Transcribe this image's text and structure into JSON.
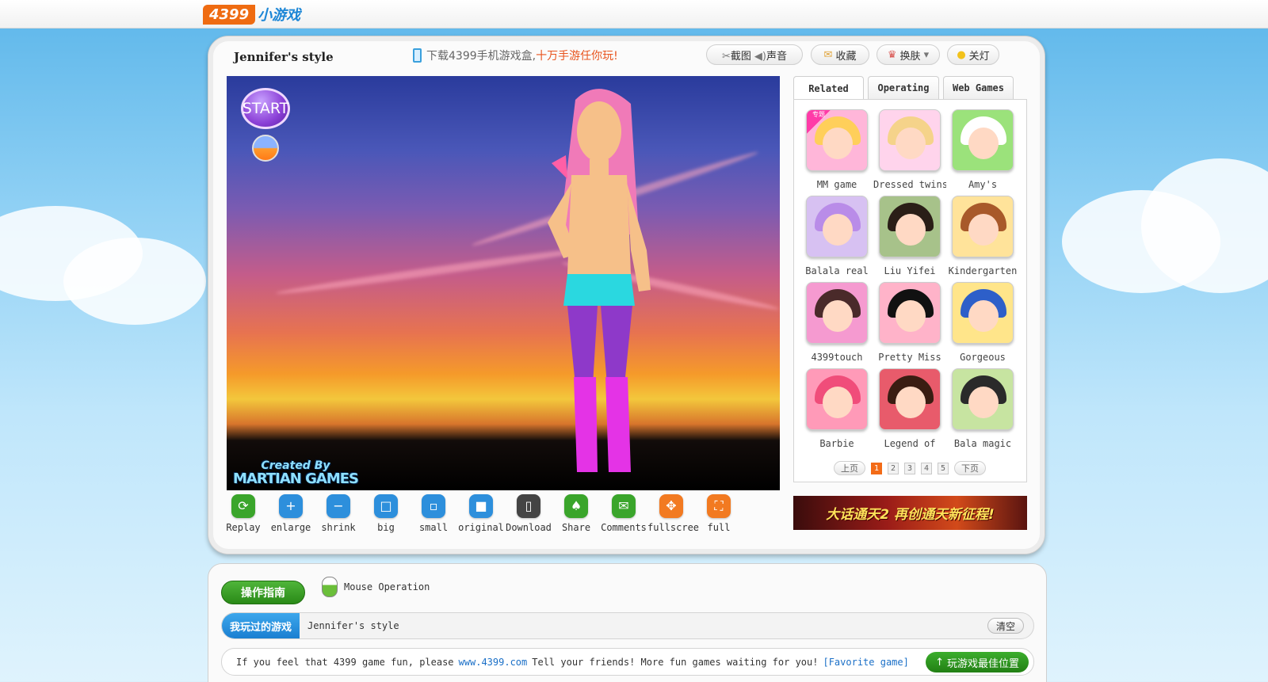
{
  "logo": {
    "number": "4399",
    "name": "小游戏"
  },
  "game": {
    "title": "Jennifer's style"
  },
  "promo": {
    "text": "下载4399手机游戏盒,",
    "highlight": "十万手游任你玩!"
  },
  "top_buttons": {
    "screenshot": "截图",
    "sound": "声音",
    "favorite": "收藏",
    "skin": "换肤",
    "lights": "关灯"
  },
  "stage": {
    "start_label": "START",
    "credit_line1": "Created By",
    "credit_line2": "MARTIAN GAMES"
  },
  "tabs": [
    {
      "label": "Related",
      "active": true
    },
    {
      "label": "Operating",
      "active": false
    },
    {
      "label": "Web Games",
      "active": false
    }
  ],
  "related_games": [
    {
      "caption": "MM game",
      "hair": "#ffcf5a",
      "bg": "#ffb6d9",
      "badge": "专题"
    },
    {
      "caption": "Dressed twins",
      "hair": "#f5d38a",
      "bg": "#ffd4ec"
    },
    {
      "caption": "Amy's",
      "hair": "#ffffff",
      "bg": "#9be27b"
    },
    {
      "caption": "Balala real",
      "hair": "#b98ce8",
      "bg": "#d7c1f2"
    },
    {
      "caption": "Liu Yifei",
      "hair": "#2a1e17",
      "bg": "#a7c28a"
    },
    {
      "caption": "Kindergarten",
      "hair": "#a8592a",
      "bg": "#ffe39a"
    },
    {
      "caption": "4399touch",
      "hair": "#4a2a2a",
      "bg": "#f59ad0"
    },
    {
      "caption": "Pretty Miss",
      "hair": "#111111",
      "bg": "#ffb3c9"
    },
    {
      "caption": "Gorgeous",
      "hair": "#2d5fc9",
      "bg": "#ffe58a"
    },
    {
      "caption": "Barbie",
      "hair": "#f04d7a",
      "bg": "#ff9ab8"
    },
    {
      "caption": "Legend of",
      "hair": "#3a1d12",
      "bg": "#e85b6b"
    },
    {
      "caption": "Bala magic",
      "hair": "#2a2a2a",
      "bg": "#c7e4a1"
    }
  ],
  "pager": {
    "prev": "上页",
    "next": "下页",
    "pages": [
      "1",
      "2",
      "3",
      "4",
      "5"
    ],
    "current": "1"
  },
  "toolbar": [
    {
      "label": "Replay",
      "icon": "⟳",
      "color": "#3aa52b"
    },
    {
      "label": "enlarge",
      "icon": "+",
      "color": "#2d8fdc"
    },
    {
      "label": "shrink",
      "icon": "−",
      "color": "#2d8fdc"
    },
    {
      "label": "big",
      "icon": "□",
      "color": "#2d8fdc"
    },
    {
      "label": "small",
      "icon": "▫",
      "color": "#2d8fdc"
    },
    {
      "label": "original",
      "icon": "■",
      "color": "#2d8fdc"
    },
    {
      "label": "Download",
      "icon": "▯",
      "color": "#444444"
    },
    {
      "label": "Share",
      "icon": "♠",
      "color": "#3aa52b"
    },
    {
      "label": "Comments",
      "icon": "✉",
      "color": "#3aa52b"
    },
    {
      "label": "fullscree",
      "icon": "✥",
      "color": "#f27a21"
    },
    {
      "label": "full",
      "icon": "⛶",
      "color": "#f27a21"
    }
  ],
  "ad_banner": {
    "text": "大话通天2 再创通天新征程!"
  },
  "guide": {
    "button": "操作指南",
    "mouse_op": "Mouse Operation"
  },
  "history": {
    "label": "我玩过的游戏",
    "game": "Jennifer's style",
    "clear": "清空"
  },
  "tip": {
    "text_before": "If you feel that 4399 game fun, please",
    "link": "www.4399.com",
    "text_after": "Tell your friends! More fun games waiting for you!",
    "favorite": "[Favorite game]",
    "best_position": "玩游戏最佳位置"
  },
  "colors": {
    "accent_orange": "#f36b17",
    "accent_blue": "#1a7fd1",
    "accent_green": "#2a8a17"
  }
}
